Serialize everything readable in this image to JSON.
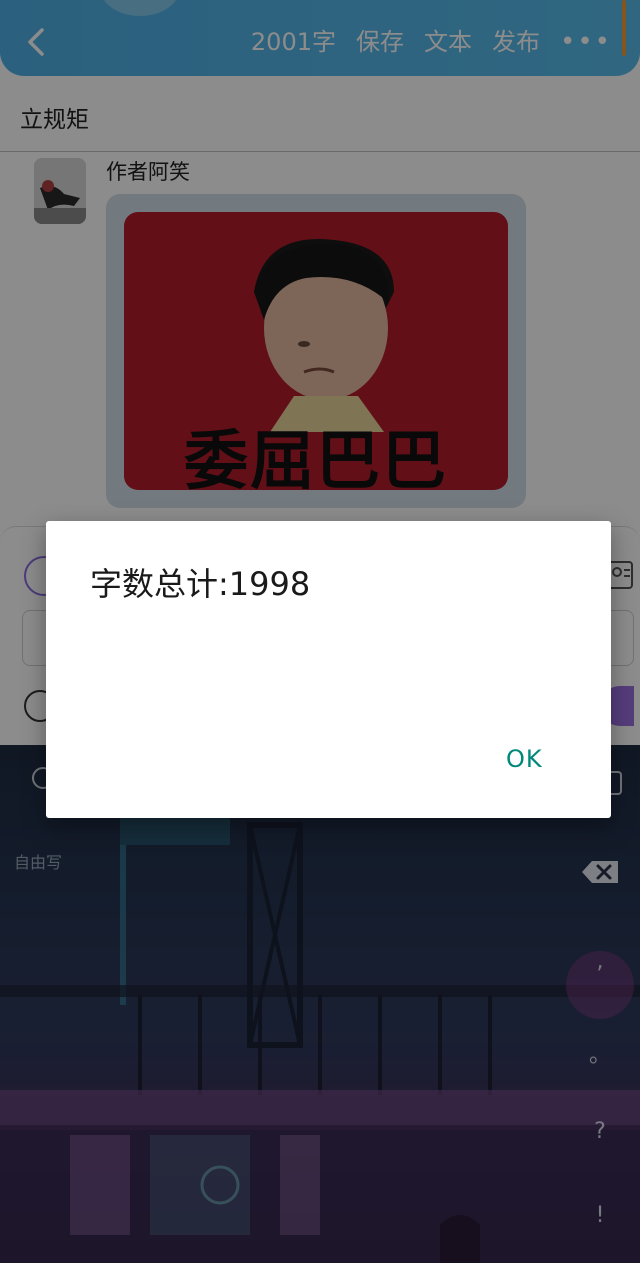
{
  "header": {
    "word_count": "2001字",
    "save_label": "保存",
    "text_label": "文本",
    "publish_label": "发布",
    "more_label": "•••",
    "accent_color": "#52b4e8"
  },
  "page": {
    "title": "立规矩"
  },
  "message": {
    "author": "作者阿笑",
    "meme_caption": "委屈巴巴"
  },
  "keyboard": {
    "mode_label": "自由写",
    "punctuation": [
      ",",
      "。",
      "?",
      "!"
    ]
  },
  "dialog": {
    "message": "字数总计:1998",
    "ok_label": "OK",
    "ok_color": "#00897b"
  }
}
